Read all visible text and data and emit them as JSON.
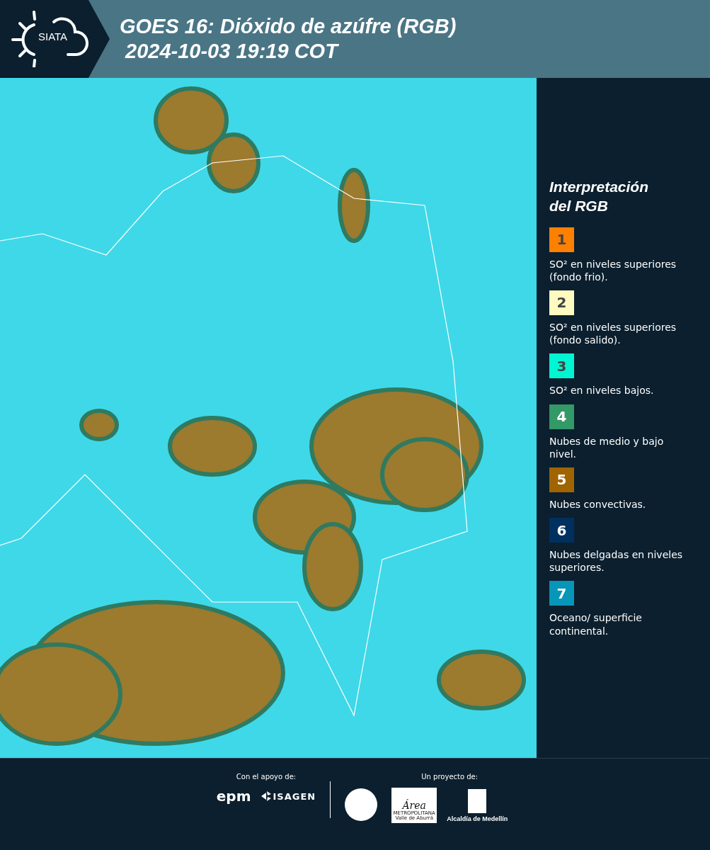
{
  "header": {
    "logo_text": "SIATA",
    "title": "GOES 16: Dióxido de azúfre (RGB)",
    "timestamp": "2024-10-03 19:19 COT"
  },
  "legend": {
    "title": "Interpretación del RGB",
    "items": [
      {
        "number": "1",
        "color": "#ff8000",
        "label": "SO² en niveles superiores (fondo frio)."
      },
      {
        "number": "2",
        "color": "#fffac0",
        "label": "SO² en niveles superiores (fondo salido)."
      },
      {
        "number": "3",
        "color": "#00f5d2",
        "label": "SO² en niveles bajos."
      },
      {
        "number": "4",
        "color": "#339966",
        "label": "Nubes de medio y bajo nivel."
      },
      {
        "number": "5",
        "color": "#a06400",
        "label": "Nubes convectivas."
      },
      {
        "number": "6",
        "color": "#003060",
        "label": "Nubes delgadas en niveles superiores."
      },
      {
        "number": "7",
        "color": "#0796b8",
        "label": "Oceano/ superficie continental."
      }
    ]
  },
  "footer": {
    "support_label": "Con el apoyo de:",
    "project_label": "Un proyecto de:",
    "epm_logo": "epm",
    "isagen_logo": "ISAGEN",
    "area_logo": "Área",
    "area_line_1": "METROPOLITANA",
    "area_line_2": "Valle de Aburrá",
    "alcaldia_logo": "Alcaldía de Medellín"
  }
}
